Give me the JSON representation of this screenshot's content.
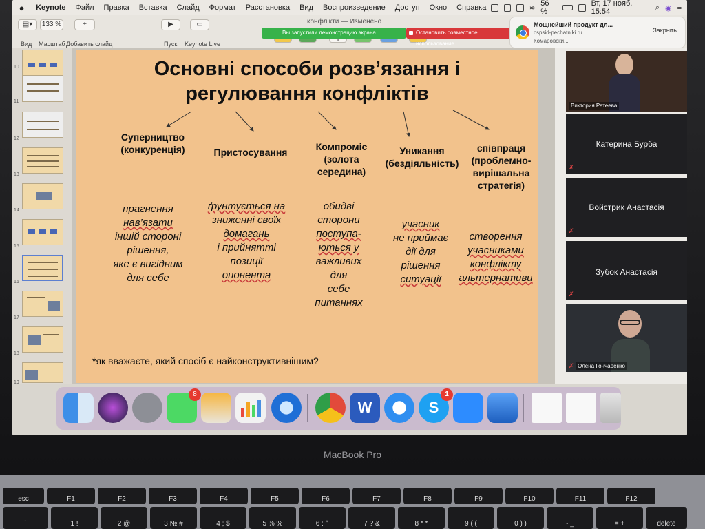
{
  "menubar": {
    "app_name": "Keynote",
    "items": [
      "Файл",
      "Правка",
      "Вставка",
      "Слайд",
      "Формат",
      "Расстановка",
      "Вид",
      "Воспроизведение",
      "Доступ",
      "Окно",
      "Справка"
    ],
    "battery": "56 %",
    "datetime": "Вт, 17 нояб. 15:54"
  },
  "toolbar": {
    "view_label": "Вид",
    "zoom_value": "133 %",
    "zoom_label": "Масштаб",
    "add_slide_label": "Добавить слайд",
    "play_label": "Пуск",
    "keynote_live_label": "Keynote Live",
    "document_title": "конфлікти",
    "document_status": "— Изменено"
  },
  "zoom_share": {
    "banner": "Вы запустили демонстрацию экрана",
    "stop_button": "Остановить совместное использование"
  },
  "notification": {
    "title": "Мощнейший продукт дл...",
    "line1": "cspsid-pechatniki.ru",
    "line2": "Комаровски...",
    "close_label": "Закрыть"
  },
  "navigator": {
    "slide_numbers": [
      "10",
      "11",
      "12",
      "13",
      "14",
      "15",
      "16",
      "17",
      "18",
      "19"
    ]
  },
  "slide": {
    "title_line1": "Основні способи розв’язання і",
    "title_line2": "регулювання конфліктів",
    "branches": [
      {
        "title": "Суперництво (конкуренція)",
        "desc": [
          "прагнення",
          "нав’язати",
          "іншій стороні",
          "рішення,",
          "яке є вигідним",
          "для себе"
        ]
      },
      {
        "title": "Пристосування",
        "desc": [
          "ґрунтується на",
          "зниженні своїх",
          "домагань",
          "і прийнятті",
          "позиції",
          "опонента"
        ]
      },
      {
        "title": "Компроміс (золота середина)",
        "desc": [
          "обидві",
          "сторони",
          "поступа-",
          "ються у",
          "важливих",
          "для",
          "себе",
          "питаннях"
        ]
      },
      {
        "title": "Уникання (бездіяльність)",
        "desc": [
          "учасник",
          "не приймає",
          "дії для",
          "рішення",
          "ситуації"
        ]
      },
      {
        "title": "співпраця (проблемно-вирішальна стратегія)",
        "desc": [
          "створення",
          "учасниками",
          "конфлікту",
          "альтернативи"
        ]
      }
    ],
    "question": "*як вважаєте, який спосіб є найконструктивнішим?"
  },
  "participants": [
    {
      "name": "Виктория Ратеева",
      "video": true
    },
    {
      "name": "Катерина Бурба",
      "video": false
    },
    {
      "name": "Войстрик Анастасія",
      "video": false
    },
    {
      "name": "Зубок Анастасія",
      "video": false
    },
    {
      "name": "Олена Гончаренко",
      "video": true
    }
  ],
  "dock": {
    "apps": [
      "finder",
      "siri",
      "launchpad",
      "messages",
      "pages",
      "numbers",
      "quicktime",
      "chrome",
      "word",
      "safari",
      "skype",
      "zoom",
      "keynote",
      "documents",
      "screenshot",
      "trash"
    ],
    "messages_badge": "8",
    "skype_badge": "1"
  },
  "hardware": {
    "brand": "MacBook Pro",
    "fn_keys": [
      "esc",
      "F1",
      "F2",
      "F3",
      "F4",
      "F5",
      "F6",
      "F7",
      "F8",
      "F9",
      "F10",
      "F11",
      "F12"
    ],
    "number_keys": [
      "`",
      "1 !",
      "2 @",
      "3 № #",
      "4 ; $",
      "5 % %",
      "6 : ^",
      "7 ? &",
      "8 * *",
      "9 ( (",
      "0 ) )",
      "- _",
      "= +",
      "delete"
    ]
  }
}
